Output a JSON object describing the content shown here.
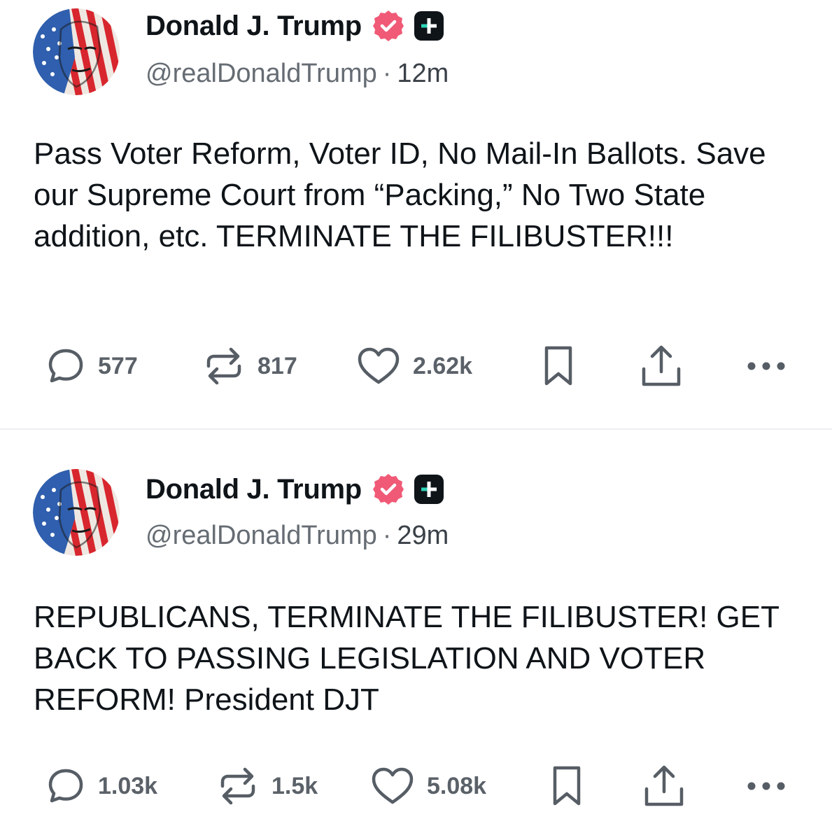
{
  "colors": {
    "text": "#0f1419",
    "muted": "#666c73",
    "icon": "#565d65",
    "verified": "#f05a77",
    "divider": "#eceef0"
  },
  "icons": {
    "verified": "verified-badge-icon",
    "plus": "truth-plus-icon",
    "reply": "speech-bubble-icon",
    "retruth": "repost-arrows-icon",
    "like": "heart-icon",
    "bookmark": "bookmark-icon",
    "share": "share-upload-icon",
    "more": "ellipsis-icon"
  },
  "posts": [
    {
      "author": "Donald J. Trump",
      "handle": "@realDonaldTrump",
      "separator": "·",
      "time": "12m",
      "text": "Pass Voter Reform, Voter ID, No Mail-In Ballots. Save our Supreme Court from “Packing,” No Two State addition, etc. TERMINATE THE FILIBUSTER!!!",
      "replies": "577",
      "retruths": "817",
      "likes": "2.62k"
    },
    {
      "author": "Donald J. Trump",
      "handle": "@realDonaldTrump",
      "separator": "·",
      "time": "29m",
      "text": "REPUBLICANS, TERMINATE THE FILIBUSTER! GET BACK TO PASSING LEGISLATION AND VOTER REFORM! President DJT",
      "replies": "1.03k",
      "retruths": "1.5k",
      "likes": "5.08k"
    }
  ]
}
